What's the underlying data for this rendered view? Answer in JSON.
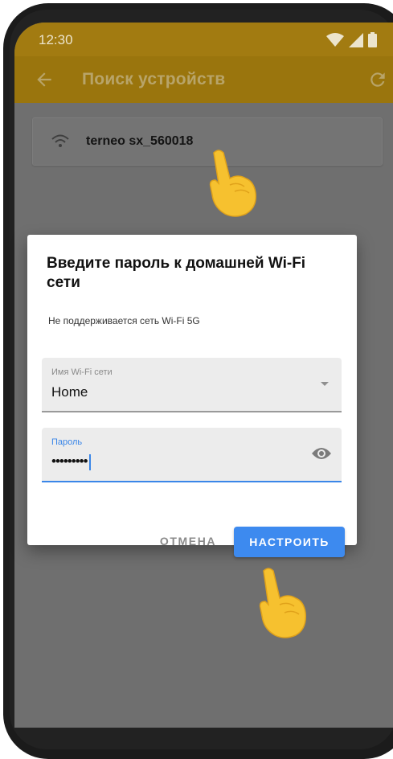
{
  "status_bar": {
    "time": "12:30",
    "icons": [
      "wifi-full-icon",
      "cell-signal-icon",
      "battery-icon"
    ]
  },
  "app_bar": {
    "back_icon": "arrow-back-icon",
    "title": "Поиск устройств",
    "refresh_icon": "refresh-icon"
  },
  "devices": [
    {
      "name": "terneo sx_560018",
      "icon": "wifi-signal-icon"
    }
  ],
  "dialog": {
    "title": "Введите пароль к домашней Wi-Fi сети",
    "note": "Не поддерживается сеть Wi-Fi 5G",
    "ssid_field": {
      "label": "Имя Wi-Fi сети",
      "value": "Home"
    },
    "password_field": {
      "label": "Пароль",
      "value": "•••••••••"
    },
    "cancel_label": "ОТМЕНА",
    "confirm_label": "НАСТРОИТЬ"
  },
  "colors": {
    "status_bar": "#a27b11",
    "app_bar": "#9a750d",
    "scrim": "#6f6f6f",
    "accent": "#3d8aef"
  }
}
